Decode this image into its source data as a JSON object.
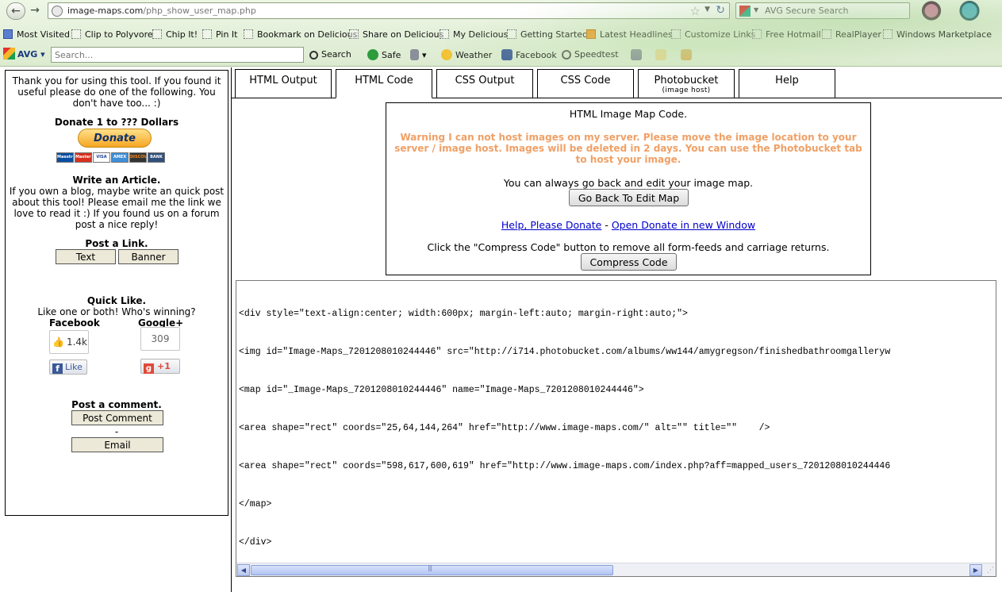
{
  "browser": {
    "url_host": "image-maps.com",
    "url_path": "/php_show_user_map.php",
    "search_engine": "AVG Secure Search"
  },
  "bookmarks": [
    "Most Visited",
    "Clip to Polyvore",
    "Chip It!",
    "Pin It",
    "Bookmark on Delicious",
    "Share on Delicious",
    "My Delicious",
    "Getting Started",
    "Latest Headlines",
    "Customize Links",
    "Free Hotmail",
    "RealPlayer",
    "Windows Marketplace"
  ],
  "avg_toolbar": {
    "logo": "AVG",
    "search_placeholder": "Search...",
    "search": "Search",
    "safe": "Safe",
    "weather": "Weather",
    "facebook": "Facebook",
    "speedtest": "Speedtest"
  },
  "sidebar": {
    "thanks": "Thank you for using this tool. If you found it useful please do one of the following. You don't have too... :)",
    "donate_head": "Donate 1 to ??? Dollars",
    "donate_button": "Donate",
    "cards": [
      "Maestro",
      "MasterCard",
      "VISA",
      "AMEX",
      "DISCOVER",
      "BANK"
    ],
    "article_head": "Write an Article.",
    "article_text": "If you own a blog, maybe write an quick post about this tool! Please email me the link we love to read it :) If you found us on a forum post a nice reply!",
    "link_head": "Post a Link.",
    "text_button": "Text",
    "banner_button": "Banner",
    "quick_like_head": "Quick Like.",
    "quick_like_text": "Like one or both! Who's winning?",
    "facebook_label": "Facebook",
    "google_label": "Google+",
    "fb_count": "1.4k",
    "fb_like": "Like",
    "gp_count": "309",
    "gp_plus": "+1",
    "comment_head": "Post a comment.",
    "post_comment": "Post Comment",
    "dash": "-",
    "email": "Email"
  },
  "tabs": [
    {
      "label": "HTML Output",
      "sub": ""
    },
    {
      "label": "HTML Code",
      "sub": ""
    },
    {
      "label": "CSS Output",
      "sub": ""
    },
    {
      "label": "CSS Code",
      "sub": ""
    },
    {
      "label": "Photobucket",
      "sub": "(image host)"
    },
    {
      "label": "Help",
      "sub": ""
    }
  ],
  "active_tab": "HTML Code",
  "info": {
    "title": "HTML Image Map Code.",
    "warning": "Warning I can not host images on my server. Please move the image location to your server / image host. Images will be deleted in 2 days. You can use the Photobucket tab to host your image.",
    "warning_color": "#f0a066",
    "go_back_text": "You can always go back and edit your image map.",
    "go_back_button": "Go Back To Edit Map",
    "help_link": "Help, Please Donate",
    "separator": "-",
    "open_link": "Open Donate in new Window",
    "compress_text": "Click the \"Compress Code\" button to remove all form-feeds and carriage returns.",
    "compress_button": "Compress Code"
  },
  "code_lines": [
    "<div style=\"text-align:center; width:600px; margin-left:auto; margin-right:auto;\">",
    "<img id=\"Image-Maps_7201208010244446\" src=\"http://i714.photobucket.com/albums/ww144/amygregson/finishedbathroomgalleryw",
    "<map id=\"_Image-Maps_7201208010244446\" name=\"Image-Maps_7201208010244446\">",
    "<area shape=\"rect\" coords=\"25,64,144,264\" href=\"http://www.image-maps.com/\" alt=\"\" title=\"\"    />",
    "<area shape=\"rect\" coords=\"598,617,600,619\" href=\"http://www.image-maps.com/index.php?aff=mapped_users_7201208010244446",
    "</map>",
    "</div>"
  ]
}
